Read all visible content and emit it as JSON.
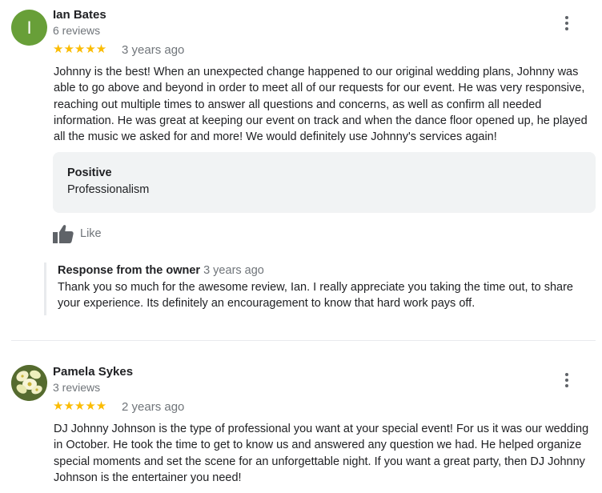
{
  "reviews": [
    {
      "avatar_letter": "I",
      "avatar_color": "#689f38",
      "name": "Ian Bates",
      "review_count": "6 reviews",
      "stars": "★★★★★",
      "rating": 5,
      "time": "3 years ago",
      "text": "Johnny is the best! When an unexpected change happened to our original wedding plans, Johnny was able to go above and beyond in order to meet all of our requests for our event. He was very responsive, reaching out multiple times to answer all questions and concerns, as well as confirm all needed information. He was great at keeping our event on track and when the dance floor opened up, he played all the music we asked for and more! We would definitely use Johnny's services again!",
      "highlight": {
        "title": "Positive",
        "value": "Professionalism"
      },
      "like_label": "Like",
      "response": {
        "title": "Response from the owner",
        "time": "3 years ago",
        "text": "Thank you so much for the awesome review, Ian. I really appreciate you taking the time out, to share your experience. Its definitely an encouragement to know that hard work pays off."
      }
    },
    {
      "avatar_icon": "flower-photo-avatar",
      "name": "Pamela Sykes",
      "review_count": "3 reviews",
      "stars": "★★★★★",
      "rating": 5,
      "time": "2 years ago",
      "text": "DJ Johnny Johnson is the type of professional you want at your special event! For us it was our wedding in October. He took the time to get to know us and answered any question we had. He helped organize special moments and set the scene for an unforgettable night. If you want a great party, then DJ Johnny Johnson is the entertainer you need!"
    }
  ],
  "colors": {
    "star": "#fbbc04",
    "secondary_text": "#70757a",
    "highlight_bg": "#f1f3f4"
  }
}
